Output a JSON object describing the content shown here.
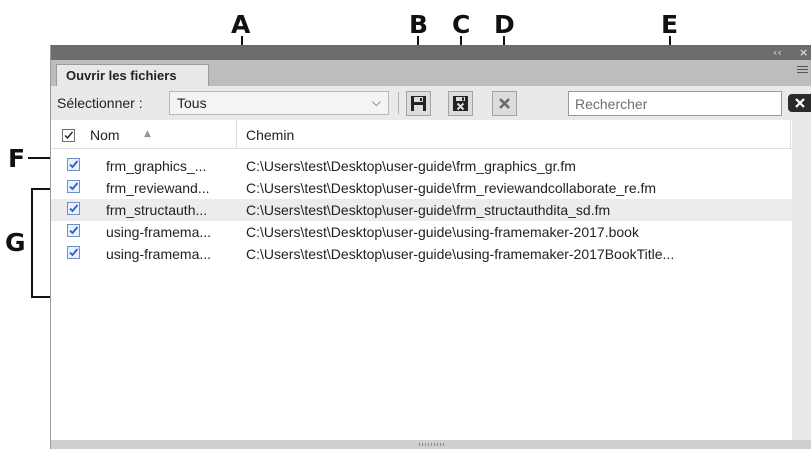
{
  "callouts": [
    "A",
    "B",
    "C",
    "D",
    "E",
    "F",
    "G"
  ],
  "titlebar": {
    "collapse_glyph": "‹‹",
    "close_glyph": "×"
  },
  "tab": {
    "label": "Ouvrir les fichiers"
  },
  "toolbar": {
    "select_label": "Sélectionner :",
    "select_value": "Tous",
    "save_icon": "save-icon",
    "save_close_icon": "save-close-icon",
    "close_icon": "close-icon"
  },
  "search": {
    "placeholder": "Rechercher",
    "value": ""
  },
  "list": {
    "header_checked": true,
    "columns": [
      "Nom",
      "Chemin"
    ],
    "rows": [
      {
        "checked": true,
        "name": "frm_graphics_...",
        "path": "C:\\Users\\test\\Desktop\\user-guide\\frm_graphics_gr.fm"
      },
      {
        "checked": true,
        "name": "frm_reviewand...",
        "path": "C:\\Users\\test\\Desktop\\user-guide\\frm_reviewandcollaborate_re.fm"
      },
      {
        "checked": true,
        "name": "frm_structauth...",
        "path": "C:\\Users\\test\\Desktop\\user-guide\\frm_structauthdita_sd.fm"
      },
      {
        "checked": true,
        "name": "using-framema...",
        "path": "C:\\Users\\test\\Desktop\\user-guide\\using-framemaker-2017.book"
      },
      {
        "checked": true,
        "name": "using-framema...",
        "path": "C:\\Users\\test\\Desktop\\user-guide\\using-framemaker-2017BookTitle..."
      }
    ]
  },
  "colors": {
    "titlebar": "#6c6c6c",
    "tabstrip": "#bdbdbd",
    "panel": "#e9e9e9",
    "check_blue": "#2d5fc4"
  }
}
